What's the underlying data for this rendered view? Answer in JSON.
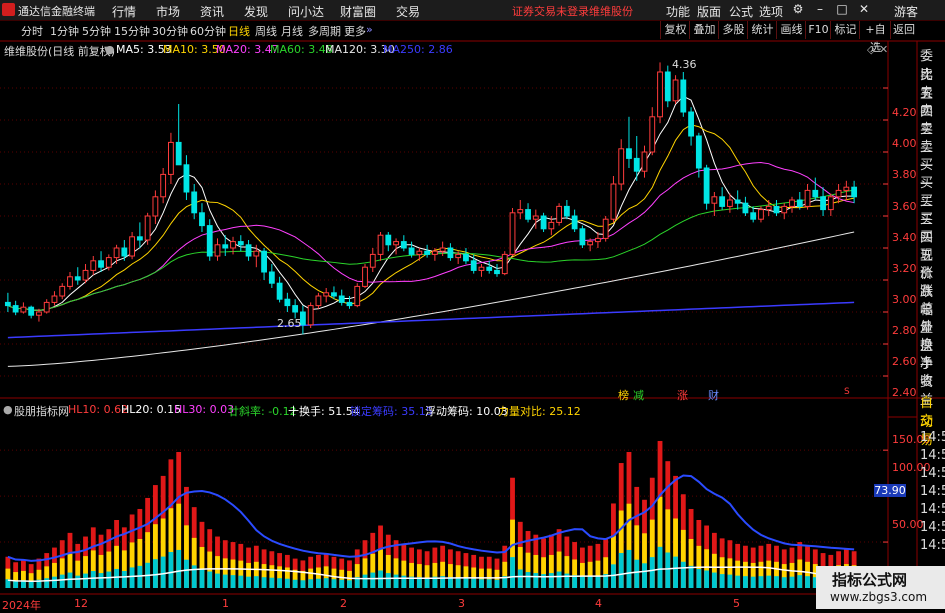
{
  "app": {
    "name": "通达信金融终端"
  },
  "menu": {
    "items": [
      "分时",
      "行情",
      "市场",
      "资讯",
      "发现",
      "问小达",
      "财富圈",
      "交易"
    ],
    "notice": "证券交易未登录",
    "stock_name": "维维股份",
    "right_items": [
      "功能",
      "版面",
      "公式",
      "选项"
    ],
    "guest": "游客"
  },
  "timeframes": {
    "items": [
      "分时",
      "1分钟",
      "5分钟",
      "15分钟",
      "30分钟",
      "60分钟",
      "日线",
      "周线",
      "月线",
      "多周期",
      "更多"
    ],
    "active": "日线"
  },
  "toolbar_right": [
    "复权",
    "叠加",
    "多股",
    "统计",
    "画线",
    "F10",
    "标记",
    "+自选",
    "返回"
  ],
  "main_legend": {
    "title": "维维股份(日线 前复权)",
    "ma": [
      {
        "label": "MA5: 3.53",
        "color": "#ffffff"
      },
      {
        "label": "MA10: 3.50",
        "color": "#ffd400"
      },
      {
        "label": "MA20: 3.47",
        "color": "#ff40ff"
      },
      {
        "label": "MA60: 3.48",
        "color": "#2bd52b"
      },
      {
        "label": "MA120: 3.30",
        "color": "#e8e8e8"
      },
      {
        "label": "MA250: 2.86",
        "color": "#3b3bff"
      }
    ]
  },
  "sub_legend": {
    "title": "股朋指标网",
    "items": [
      {
        "label": "HL10: 0.62",
        "color": "#ff3c3c"
      },
      {
        "label": "HL20: 0.15",
        "color": "#ffffff"
      },
      {
        "label": "HL30: 0.03",
        "color": "#ff40ff"
      },
      {
        "label": "廿斜率: -0.12",
        "color": "#2bd52b"
      },
      {
        "label": "十换手: 51.54",
        "color": "#ffffff"
      },
      {
        "label": "锁定筹码: 35.15",
        "color": "#3b3bff"
      },
      {
        "label": "浮动筹码: 10.03",
        "color": "#ffffff"
      },
      {
        "label": "力量对比: 25.12",
        "color": "#ffd400"
      }
    ]
  },
  "price_axis": [
    "4.20",
    "4.00",
    "3.80",
    "3.60",
    "3.40",
    "3.20",
    "3.00",
    "2.80",
    "2.60",
    "2.40"
  ],
  "sub_axis": [
    "150.00",
    "100.00",
    "50.00"
  ],
  "sub_current": "73.90",
  "annotations": {
    "high": "4.36",
    "low": "2.65"
  },
  "event_marks": [
    {
      "text": "榜",
      "color": "#ffd400"
    },
    {
      "text": "减",
      "color": "#2bd52b"
    },
    {
      "text": "涨",
      "color": "#ff3c3c"
    },
    {
      "text": "财",
      "color": "#6a8cff"
    },
    {
      "text": "S",
      "color": "#ff3c3c"
    }
  ],
  "date_axis": [
    "2024年",
    "12",
    "1",
    "2",
    "3",
    "4",
    "5"
  ],
  "side_panel": [
    "委比",
    "卖五",
    "卖四",
    "卖三",
    "卖二",
    "卖一",
    "买一",
    "买二",
    "买三",
    "买四",
    "买五",
    "现价",
    "涨跌",
    "涨幅",
    "总量",
    "外盘",
    "换手",
    "净资",
    "收益"
  ],
  "side_lower": [
    "自动",
    "交易",
    "14:5",
    "14:5",
    "14:5",
    "14:5",
    "14:5",
    "14:5",
    "14:5",
    "14:5"
  ],
  "watermark": {
    "line1": "指标公式网",
    "line2": "www.zbgs3.com"
  },
  "colors": {
    "up": "#ff3c3c",
    "down": "#00e5e5",
    "grid": "#5a0000",
    "axis": "#8b0000"
  },
  "chart_data": {
    "type": "candlestick",
    "ohlc": [
      [
        2.86,
        2.92,
        2.8,
        2.84
      ],
      [
        2.84,
        2.87,
        2.78,
        2.8
      ],
      [
        2.8,
        2.86,
        2.79,
        2.83
      ],
      [
        2.83,
        2.84,
        2.76,
        2.78
      ],
      [
        2.78,
        2.82,
        2.74,
        2.8
      ],
      [
        2.8,
        2.88,
        2.79,
        2.86
      ],
      [
        2.86,
        2.93,
        2.84,
        2.9
      ],
      [
        2.9,
        2.98,
        2.88,
        2.96
      ],
      [
        2.96,
        3.05,
        2.94,
        3.02
      ],
      [
        3.02,
        3.08,
        2.97,
        3.0
      ],
      [
        3.0,
        3.1,
        2.98,
        3.06
      ],
      [
        3.06,
        3.15,
        3.03,
        3.12
      ],
      [
        3.12,
        3.18,
        3.05,
        3.08
      ],
      [
        3.08,
        3.16,
        3.06,
        3.14
      ],
      [
        3.14,
        3.22,
        3.1,
        3.2
      ],
      [
        3.2,
        3.25,
        3.12,
        3.15
      ],
      [
        3.15,
        3.3,
        3.13,
        3.27
      ],
      [
        3.27,
        3.36,
        3.2,
        3.25
      ],
      [
        3.25,
        3.42,
        3.22,
        3.4
      ],
      [
        3.4,
        3.56,
        3.35,
        3.52
      ],
      [
        3.52,
        3.7,
        3.48,
        3.66
      ],
      [
        3.66,
        3.92,
        3.6,
        3.86
      ],
      [
        3.86,
        4.1,
        3.78,
        3.72
      ],
      [
        3.72,
        3.78,
        3.5,
        3.55
      ],
      [
        3.55,
        3.6,
        3.38,
        3.42
      ],
      [
        3.42,
        3.48,
        3.3,
        3.34
      ],
      [
        3.34,
        3.38,
        3.12,
        3.15
      ],
      [
        3.15,
        3.26,
        3.12,
        3.22
      ],
      [
        3.22,
        3.28,
        3.15,
        3.2
      ],
      [
        3.2,
        3.27,
        3.16,
        3.24
      ],
      [
        3.24,
        3.28,
        3.18,
        3.22
      ],
      [
        3.22,
        3.25,
        3.12,
        3.15
      ],
      [
        3.15,
        3.22,
        3.08,
        3.18
      ],
      [
        3.18,
        3.2,
        3.0,
        3.05
      ],
      [
        3.05,
        3.1,
        2.95,
        2.98
      ],
      [
        2.98,
        3.02,
        2.86,
        2.88
      ],
      [
        2.88,
        2.92,
        2.8,
        2.84
      ],
      [
        2.84,
        2.88,
        2.76,
        2.8
      ],
      [
        2.8,
        2.84,
        2.66,
        2.72
      ],
      [
        2.72,
        2.86,
        2.7,
        2.84
      ],
      [
        2.84,
        2.92,
        2.82,
        2.9
      ],
      [
        2.9,
        2.95,
        2.86,
        2.92
      ],
      [
        2.92,
        2.96,
        2.88,
        2.9
      ],
      [
        2.9,
        2.94,
        2.84,
        2.86
      ],
      [
        2.86,
        2.9,
        2.82,
        2.84
      ],
      [
        2.84,
        2.98,
        2.83,
        2.96
      ],
      [
        2.96,
        3.1,
        2.95,
        3.08
      ],
      [
        3.08,
        3.2,
        3.05,
        3.16
      ],
      [
        3.16,
        3.3,
        3.12,
        3.28
      ],
      [
        3.28,
        3.3,
        3.18,
        3.22
      ],
      [
        3.22,
        3.26,
        3.16,
        3.24
      ],
      [
        3.24,
        3.28,
        3.18,
        3.2
      ],
      [
        3.2,
        3.24,
        3.14,
        3.16
      ],
      [
        3.16,
        3.2,
        3.12,
        3.18
      ],
      [
        3.18,
        3.22,
        3.14,
        3.16
      ],
      [
        3.16,
        3.2,
        3.12,
        3.18
      ],
      [
        3.18,
        3.24,
        3.15,
        3.2
      ],
      [
        3.2,
        3.23,
        3.12,
        3.14
      ],
      [
        3.14,
        3.18,
        3.1,
        3.16
      ],
      [
        3.16,
        3.2,
        3.1,
        3.12
      ],
      [
        3.12,
        3.16,
        3.04,
        3.06
      ],
      [
        3.06,
        3.1,
        3.02,
        3.08
      ],
      [
        3.08,
        3.12,
        3.04,
        3.06
      ],
      [
        3.06,
        3.1,
        3.02,
        3.04
      ],
      [
        3.04,
        3.18,
        3.03,
        3.16
      ],
      [
        3.16,
        3.45,
        3.15,
        3.42
      ],
      [
        3.42,
        3.5,
        3.38,
        3.44
      ],
      [
        3.44,
        3.48,
        3.36,
        3.38
      ],
      [
        3.38,
        3.44,
        3.32,
        3.4
      ],
      [
        3.4,
        3.42,
        3.3,
        3.32
      ],
      [
        3.32,
        3.4,
        3.28,
        3.36
      ],
      [
        3.36,
        3.48,
        3.34,
        3.46
      ],
      [
        3.46,
        3.5,
        3.38,
        3.4
      ],
      [
        3.4,
        3.44,
        3.3,
        3.32
      ],
      [
        3.32,
        3.34,
        3.2,
        3.22
      ],
      [
        3.22,
        3.26,
        3.18,
        3.24
      ],
      [
        3.24,
        3.3,
        3.2,
        3.26
      ],
      [
        3.26,
        3.4,
        3.24,
        3.38
      ],
      [
        3.38,
        3.65,
        3.36,
        3.6
      ],
      [
        3.6,
        3.88,
        3.56,
        3.82
      ],
      [
        3.82,
        4.02,
        3.7,
        3.76
      ],
      [
        3.76,
        3.9,
        3.62,
        3.68
      ],
      [
        3.68,
        3.84,
        3.64,
        3.8
      ],
      [
        3.8,
        4.08,
        3.78,
        4.02
      ],
      [
        4.02,
        4.36,
        3.98,
        4.3
      ],
      [
        4.3,
        4.34,
        4.08,
        4.12
      ],
      [
        4.12,
        4.28,
        4.1,
        4.25
      ],
      [
        4.25,
        4.3,
        4.02,
        4.05
      ],
      [
        4.05,
        4.08,
        3.84,
        3.9
      ],
      [
        3.9,
        3.92,
        3.64,
        3.7
      ],
      [
        3.7,
        3.72,
        3.44,
        3.48
      ],
      [
        3.48,
        3.55,
        3.4,
        3.52
      ],
      [
        3.52,
        3.58,
        3.44,
        3.46
      ],
      [
        3.46,
        3.54,
        3.42,
        3.5
      ],
      [
        3.5,
        3.56,
        3.44,
        3.48
      ],
      [
        3.48,
        3.52,
        3.4,
        3.42
      ],
      [
        3.42,
        3.46,
        3.36,
        3.38
      ],
      [
        3.38,
        3.46,
        3.36,
        3.44
      ],
      [
        3.44,
        3.5,
        3.4,
        3.46
      ],
      [
        3.46,
        3.5,
        3.4,
        3.42
      ],
      [
        3.42,
        3.48,
        3.38,
        3.46
      ],
      [
        3.46,
        3.52,
        3.42,
        3.5
      ],
      [
        3.5,
        3.55,
        3.44,
        3.46
      ],
      [
        3.46,
        3.6,
        3.44,
        3.56
      ],
      [
        3.56,
        3.64,
        3.5,
        3.52
      ],
      [
        3.52,
        3.58,
        3.4,
        3.44
      ],
      [
        3.44,
        3.54,
        3.4,
        3.52
      ],
      [
        3.52,
        3.6,
        3.48,
        3.56
      ],
      [
        3.56,
        3.62,
        3.5,
        3.58
      ],
      [
        3.58,
        3.62,
        3.48,
        3.52
      ]
    ],
    "volume": [
      34,
      28,
      30,
      26,
      32,
      38,
      44,
      52,
      60,
      48,
      56,
      66,
      58,
      64,
      74,
      66,
      80,
      86,
      98,
      112,
      122,
      140,
      148,
      110,
      88,
      72,
      64,
      56,
      52,
      50,
      48,
      44,
      46,
      42,
      40,
      38,
      36,
      32,
      30,
      34,
      36,
      38,
      34,
      32,
      30,
      42,
      52,
      60,
      68,
      58,
      52,
      48,
      44,
      42,
      40,
      44,
      46,
      42,
      40,
      38,
      36,
      34,
      34,
      32,
      46,
      120,
      72,
      62,
      58,
      54,
      58,
      64,
      56,
      50,
      44,
      46,
      48,
      54,
      92,
      136,
      148,
      110,
      96,
      120,
      160,
      138,
      122,
      102,
      86,
      74,
      68,
      60,
      54,
      52,
      48,
      46,
      44,
      46,
      48,
      46,
      42,
      44,
      50,
      46,
      42,
      38,
      36,
      40,
      42,
      40
    ],
    "series_labels": [
      "MA5",
      "MA10",
      "MA20",
      "MA60",
      "MA120",
      "MA250"
    ]
  }
}
